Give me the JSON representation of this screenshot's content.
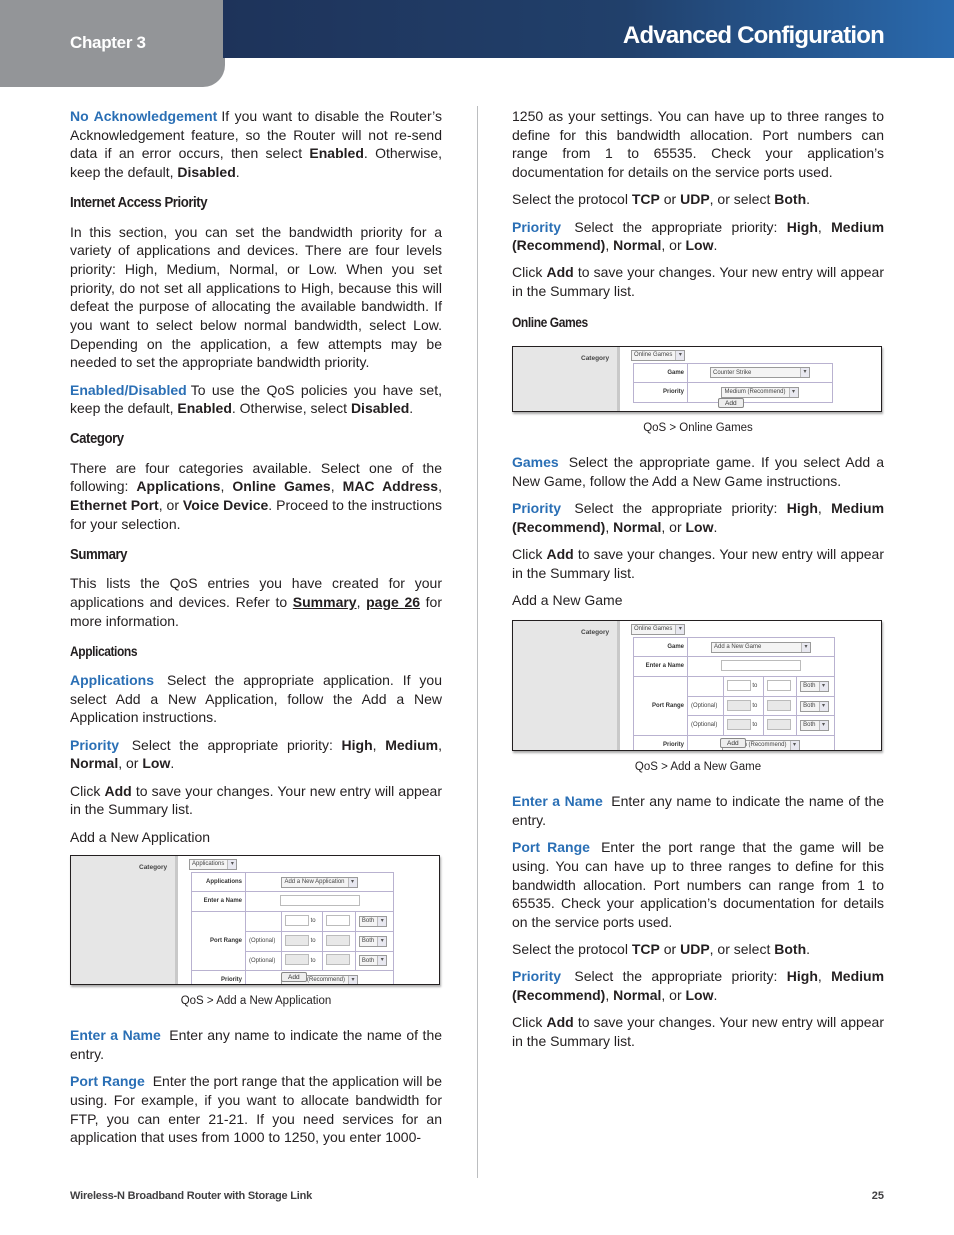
{
  "header": {
    "chapter": "Chapter 3",
    "title": "Advanced Configuration",
    "colors": {
      "chapter_bg": "#939598",
      "bar_start": "#1e335a",
      "bar_end": "#2a6aae",
      "term_blue": "#2a6fb5"
    }
  },
  "left": {
    "no_ack": {
      "term": "No Acknowledgement",
      "t1": "If you want to disable the Router’s Acknowledgement feature, so the Router will not re-send data if an error occurs, then select ",
      "b1": "Enabled",
      "t2": ". Otherwise, keep the default, ",
      "b2": "Disabled",
      "t3": "."
    },
    "iap_heading": "Internet Access Priority",
    "iap_text": "In this section, you can set the bandwidth priority for a variety of applications and devices. There are four levels priority: High, Medium, Normal, or Low. When you set priority, do not set all applications to High, because this will defeat the purpose of allocating the available bandwidth. If you want to select below normal bandwidth, select Low. Depending on the application, a few attempts may be needed to set the appropriate bandwidth priority.",
    "enabled": {
      "term": "Enabled/Disabled",
      "t1": "To use the QoS policies you have set, keep the default, ",
      "b1": "Enabled",
      "t2": ". Otherwise, select ",
      "b2": "Disabled",
      "t3": "."
    },
    "category_heading": "Category",
    "category": {
      "t1": "There are four categories available. Select one of the following: ",
      "b1": "Applications",
      "s1": ", ",
      "b2": "Online Games",
      "s2": ", ",
      "b3": "MAC Address",
      "s3": ", ",
      "b4": "Ethernet Port",
      "s4": ", or ",
      "b5": "Voice Device",
      "t2": ". Proceed to the instructions for your selection."
    },
    "summary_heading": "Summary",
    "summary": {
      "t1": "This lists the QoS entries you have created for your applications and devices. Refer to ",
      "l1": "Summary",
      "s1": ", ",
      "l2": "page 26",
      "t2": " for more information."
    },
    "applications_heading": "Applications",
    "applications": {
      "term": "Applications",
      "text": "Select the appropriate application. If you select Add a New Application, follow the Add a New Application instructions."
    },
    "priority": {
      "term": "Priority",
      "t1": "Select the appropriate priority: ",
      "b1": "High",
      "s1": ", ",
      "b2": "Medium",
      "s2": ", ",
      "b3": "Normal",
      "s3": ", or ",
      "b4": "Low",
      "t2": "."
    },
    "click_add": {
      "t1": "Click ",
      "b1": "Add",
      "t2": " to save your changes. Your new entry will appear in the Summary list."
    },
    "add_new_app": "Add a New Application",
    "caption_app": "QoS > Add a New Application",
    "enter_name": {
      "term": "Enter a Name",
      "text": "Enter any name to indicate the name of the entry."
    },
    "port_range": {
      "term": "Port Range",
      "text": "Enter the port range that the application will be using. For example, if you want to allocate bandwidth for FTP, you can enter 21-21. If you need services for an application that uses from 1000 to 1250, you enter 1000-"
    }
  },
  "right": {
    "cont": "1250 as your settings. You can have up to three ranges to define for this bandwidth allocation. Port numbers can range from 1 to 65535. Check your application’s documentation for details on the service ports used.",
    "protocol": {
      "t1": "Select the protocol ",
      "b1": "TCP",
      "t2": " or ",
      "b2": "UDP",
      "t3": ", or select ",
      "b3": "Both",
      "t4": "."
    },
    "priority": {
      "term": "Priority",
      "t1": "Select the appropriate priority: ",
      "b1": "High",
      "s1": ", ",
      "b2": "Medium (Recommend)",
      "s2": ", ",
      "b3": "Normal",
      "s3": ", or ",
      "b4": "Low",
      "t2": "."
    },
    "click_add": {
      "t1": "Click ",
      "b1": "Add",
      "t2": " to save your changes. Your new entry will appear in the Summary list."
    },
    "online_games_heading": "Online Games",
    "caption_games": "QoS > Online Games",
    "games": {
      "term": "Games",
      "text": "Select the appropriate game. If you select Add a New Game, follow the Add a New Game instructions."
    },
    "add_new_game": "Add a New Game",
    "caption_new_game": "QoS > Add a New Game",
    "enter_name": {
      "term": "Enter a Name",
      "text": "Enter any name to indicate the name of the entry."
    },
    "port_range": {
      "term": "Port Range",
      "text": "Enter the port range that the game will be using. You can have up to three ranges to define for this bandwidth allocation. Port numbers can range from 1 to 65535. Check your application’s documentation for details on the service ports used."
    }
  },
  "shots": {
    "category_label": "Category",
    "applications_label": "Applications",
    "game_label": "Game",
    "enter_name_label": "Enter a Name",
    "port_range_label": "Port Range",
    "priority_label": "Priority",
    "to": "to",
    "optional": "(Optional)",
    "both": "Both",
    "add": "Add",
    "arrow": "▾",
    "app": {
      "category": "Applications",
      "application": "Add a New Application",
      "priority": "Medium (Recommend)"
    },
    "games": {
      "category": "Online Games",
      "game": "Counter Strike",
      "priority": "Medium (Recommend)"
    },
    "new_game": {
      "category": "Online Games",
      "game": "Add a New Game",
      "priority": "Medium (Recommend)"
    }
  },
  "footer": {
    "product": "Wireless-N Broadband Router with Storage Link",
    "page": "25"
  }
}
